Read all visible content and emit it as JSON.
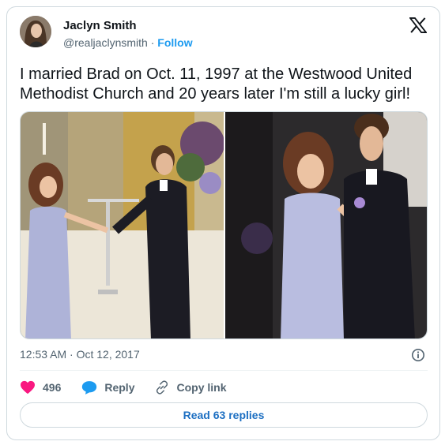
{
  "author": {
    "name": "Jaclyn Smith",
    "handle": "@realjaclynsmith",
    "separator": "·",
    "follow_label": "Follow"
  },
  "tweet": {
    "text": "I married Brad on Oct. 11, 1997 at the Westwood United Methodist Church and 20 years later I'm still a lucky girl!",
    "timestamp": "12:53 AM · Oct 12, 2017"
  },
  "actions": {
    "likes_count": "496",
    "reply_label": "Reply",
    "copy_link_label": "Copy link"
  },
  "read_replies_label": "Read 63 replies",
  "colors": {
    "accent_blue": "#1d9bf0",
    "like_pink": "#f91880",
    "text_primary": "#0f1419",
    "text_secondary": "#536471",
    "border": "#cfd9de"
  },
  "icons": [
    "x-logo-icon",
    "info-icon",
    "heart-icon",
    "reply-bubble-icon",
    "link-icon"
  ]
}
